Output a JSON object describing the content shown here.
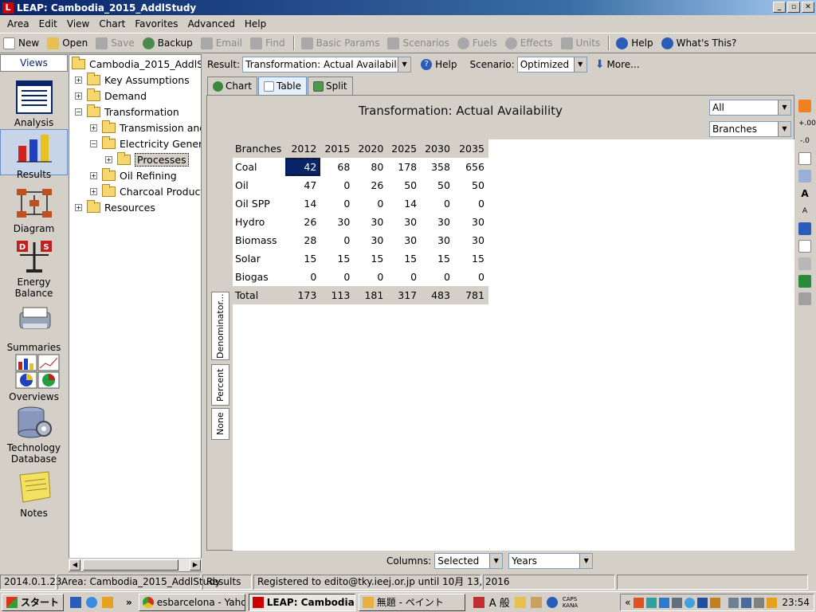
{
  "window": {
    "title": "LEAP: Cambodia_2015_AddlStudy",
    "app_icon": "L"
  },
  "menu": [
    "Area",
    "Edit",
    "View",
    "Chart",
    "Favorites",
    "Advanced",
    "Help"
  ],
  "toolbar": {
    "new": "New",
    "open": "Open",
    "save": "Save",
    "backup": "Backup",
    "email": "Email",
    "find": "Find",
    "basic_params": "Basic Params",
    "scenarios": "Scenarios",
    "fuels": "Fuels",
    "effects": "Effects",
    "units": "Units",
    "help": "Help",
    "whats_this": "What's This?"
  },
  "views": {
    "header": "Views",
    "items": [
      "Analysis",
      "Results",
      "Diagram",
      "Energy Balance",
      "Summaries",
      "Overviews",
      "Technology Database",
      "Notes"
    ]
  },
  "tree": {
    "root": "Cambodia_2015_AddlStu",
    "key_assumptions": "Key Assumptions",
    "demand": "Demand",
    "transformation": "Transformation",
    "transmission": "Transmission and",
    "electricity": "Electricity Generat",
    "processes": "Processes",
    "oil_refining": "Oil Refining",
    "charcoal": "Charcoal Producti",
    "resources": "Resources"
  },
  "results_bar": {
    "result_label": "Result:",
    "result_value": "Transformation: Actual Availability",
    "help": "Help",
    "scenario_label": "Scenario:",
    "scenario_value": "Optimized",
    "more": "More..."
  },
  "tabs": {
    "chart": "Chart",
    "table": "Table",
    "split": "Split"
  },
  "view_title": "Transformation: Actual Availability",
  "filters": {
    "all": "All",
    "branches": "Branches"
  },
  "side_tabs": {
    "denominator": "Denominator...",
    "percent": "Percent",
    "none": "None"
  },
  "table": {
    "header": [
      "Branches",
      "2012",
      "2015",
      "2020",
      "2025",
      "2030",
      "2035"
    ],
    "rows": [
      [
        "Coal",
        "42",
        "68",
        "80",
        "178",
        "358",
        "656"
      ],
      [
        "Oil",
        "47",
        "0",
        "26",
        "50",
        "50",
        "50"
      ],
      [
        "Oil SPP",
        "14",
        "0",
        "0",
        "14",
        "0",
        "0"
      ],
      [
        "Hydro",
        "26",
        "30",
        "30",
        "30",
        "30",
        "30"
      ],
      [
        "Biomass",
        "28",
        "0",
        "30",
        "30",
        "30",
        "30"
      ],
      [
        "Solar",
        "15",
        "15",
        "15",
        "15",
        "15",
        "15"
      ],
      [
        "Biogas",
        "0",
        "0",
        "0",
        "0",
        "0",
        "0"
      ]
    ],
    "total": [
      "Total",
      "173",
      "113",
      "181",
      "317",
      "483",
      "781"
    ]
  },
  "columns_bar": {
    "label": "Columns:",
    "selected": "Selected",
    "years": "Years"
  },
  "status": {
    "version": "2014.0.1.23",
    "area": "Area: Cambodia_2015_AddlStudy",
    "view": "Results",
    "registered": "Registered to edito@tky.ieej.or.jp until 10月 13, 2016"
  },
  "taskbar": {
    "start": "スタート",
    "chevron": "»",
    "task1": "esbarcelona - Yaho...",
    "task2": "LEAP: Cambodia...",
    "task3": "無題 - ペイント",
    "ime": "A 般",
    "caps": "CAPS",
    "kana": "KANA",
    "clock": "23:54"
  },
  "colors": {
    "accent": "#0a246a",
    "face": "#d4d0c8",
    "title_gradient_end": "#a6caf0"
  }
}
